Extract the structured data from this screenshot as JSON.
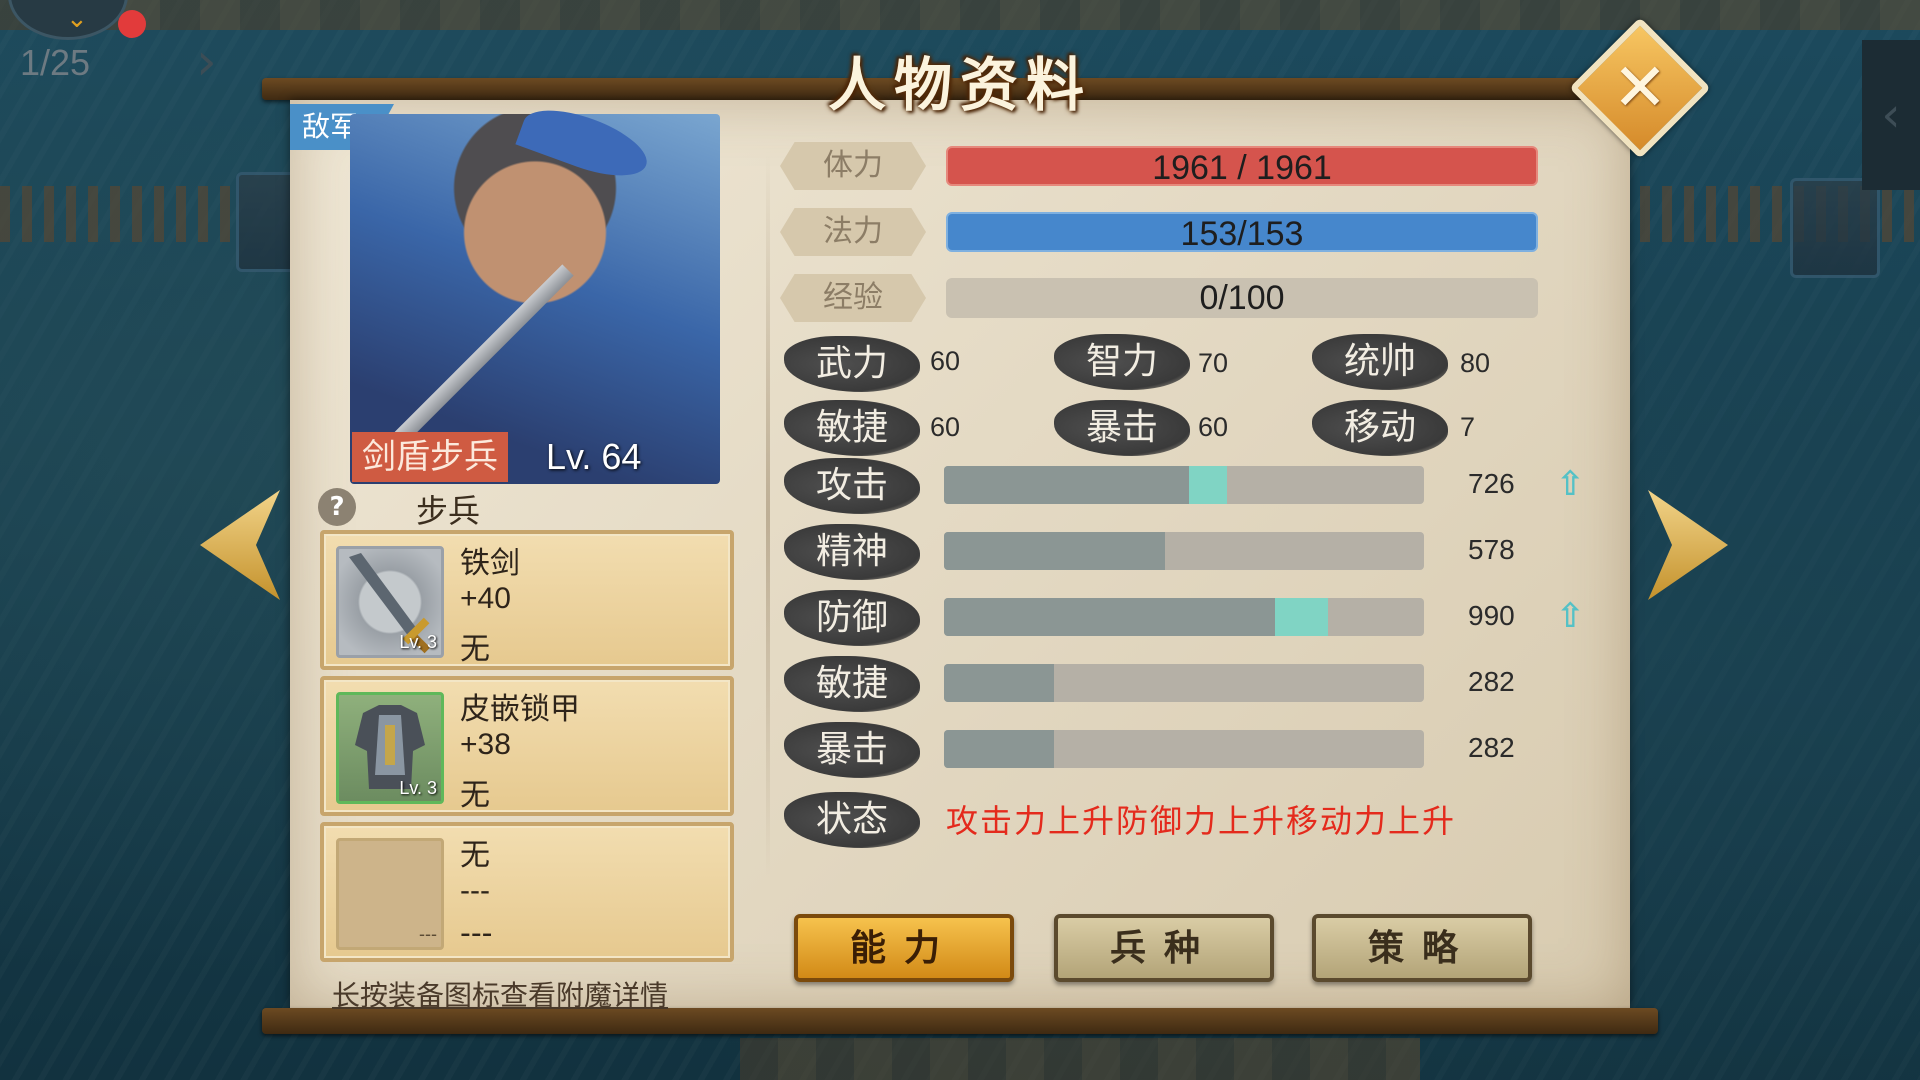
{
  "hud": {
    "page_counter": "1/25"
  },
  "title": "人物资料",
  "faction": "敌军",
  "unit": {
    "class_name": "剑盾步兵",
    "level": "Lv. 64",
    "type": "步兵"
  },
  "equipment": [
    {
      "name": "铁剑",
      "bonus": "+40",
      "extra": "无",
      "level": "Lv. 3",
      "icon": "iron-sword-icon"
    },
    {
      "name": "皮嵌锁甲",
      "bonus": "+38",
      "extra": "无",
      "level": "Lv. 3",
      "icon": "leather-chainmail-icon"
    },
    {
      "name": "无",
      "bonus": "---",
      "extra": "---",
      "level": "---",
      "icon": "empty-slot"
    }
  ],
  "hint": "长按装备图标查看附魔详情",
  "vitals": {
    "hp": {
      "label": "体力",
      "value": "1961  /  1961"
    },
    "mp": {
      "label": "法力",
      "value": "153/153"
    },
    "xp": {
      "label": "经验",
      "value": "0/100",
      "progress": 0
    }
  },
  "attributes": [
    {
      "label": "武力",
      "value": "60"
    },
    {
      "label": "智力",
      "value": "70"
    },
    {
      "label": "统帅",
      "value": "80"
    },
    {
      "label": "敏捷",
      "value": "60"
    },
    {
      "label": "暴击",
      "value": "60"
    },
    {
      "label": "移动",
      "value": "7"
    }
  ],
  "stats": [
    {
      "label": "攻击",
      "value": "726",
      "fill": 0.51,
      "boost": 0.08,
      "boosted": true
    },
    {
      "label": "精神",
      "value": "578",
      "fill": 0.46,
      "boost": 0,
      "boosted": false
    },
    {
      "label": "防御",
      "value": "990",
      "fill": 0.69,
      "boost": 0.11,
      "boosted": true
    },
    {
      "label": "敏捷",
      "value": "282",
      "fill": 0.23,
      "boost": 0,
      "boosted": false
    },
    {
      "label": "暴击",
      "value": "282",
      "fill": 0.23,
      "boost": 0,
      "boosted": false
    }
  ],
  "status": {
    "label": "状态",
    "text": "攻击力上升防御力上升移动力上升"
  },
  "tabs": [
    {
      "label": "能力",
      "active": true
    },
    {
      "label": "兵种",
      "active": false
    },
    {
      "label": "策略",
      "active": false
    }
  ],
  "colors": {
    "hp_bar": "#d5544d",
    "mp_bar": "#4687cc",
    "boost": "#80d4c4",
    "status_text": "#e42a1c",
    "active_tab": "#f6c24d"
  }
}
